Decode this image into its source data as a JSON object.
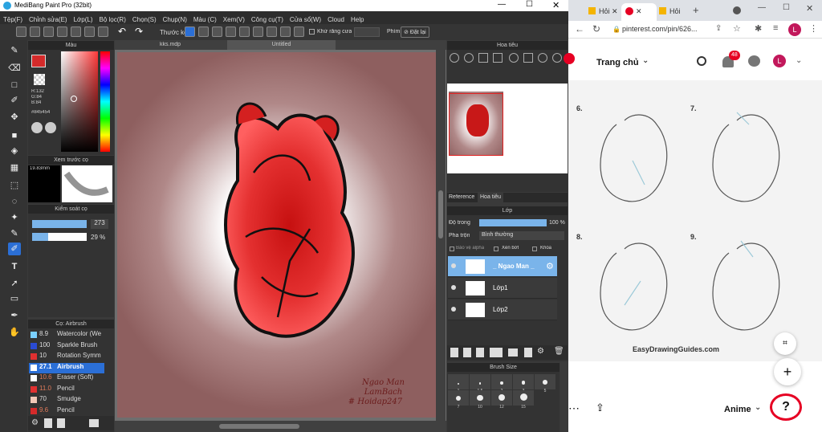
{
  "app": {
    "title": "MediBang Paint Pro (32bit)",
    "menu": [
      "Tệp(F)",
      "Chỉnh sửa(E)",
      "Lớp(L)",
      "Bộ lọc(R)",
      "Chọn(S)",
      "Chụp(N)",
      "Màu (C)",
      "Xem(V)",
      "Công cụ(T)",
      "Cửa sổ(W)",
      "Cloud",
      "Help"
    ],
    "toolbar": {
      "ruler_label": "Thước kẻ",
      "aa_label": "Khử răng cưa",
      "key_label": "Phím",
      "reset_label": "Đặt lại"
    },
    "doc_tabs": [
      "kks.mdp",
      "Untitled"
    ]
  },
  "color_panel": {
    "title": "Màu",
    "rgb": [
      "R:132",
      "G:84",
      "B:84"
    ],
    "hex": "#845454",
    "primary": "#d42a2a"
  },
  "brush_preview": {
    "title": "Xem trước cọ",
    "size": "19.83mm"
  },
  "brush_control": {
    "title": "Kiểm soát cọ",
    "size": "273",
    "opacity": "29 %"
  },
  "brush_list": {
    "title": "Cọ: Airbrush",
    "items": [
      {
        "size": "8.9",
        "name": "Watercolor (We",
        "color": "#7ad0ff"
      },
      {
        "size": "100",
        "name": "Sparkle Brush",
        "color": "#2a4bd4"
      },
      {
        "size": "10",
        "name": "Rotation Symm",
        "color": "#e03030"
      },
      {
        "size": "27.1",
        "name": "Airbrush",
        "color": "#ffffff"
      },
      {
        "size": "10.6",
        "name": "Eraser (Soft)",
        "color": "#ffffff"
      },
      {
        "size": "11.0",
        "name": "Pencil",
        "color": "#e03030"
      },
      {
        "size": "70",
        "name": "Smudge",
        "color": "#f2c8b8"
      },
      {
        "size": "9.6",
        "name": "Pencil",
        "color": "#d42a2a"
      }
    ]
  },
  "canvas": {
    "signature": [
      "Ngao Man",
      "LamBach",
      "# Hoidap247"
    ]
  },
  "navigator": {
    "title": "Hoa tiêu"
  },
  "reference_tabs": [
    "Reference",
    "Hoa tiêu"
  ],
  "layer_panel": {
    "title": "Lớp",
    "opacity_label": "Độ trong",
    "opacity": "100 %",
    "blend_label": "Pha trộn",
    "blend": "Bình thường",
    "checks": [
      "Bảo vệ alpha",
      "Xén bớt",
      "Khóa"
    ],
    "layers": [
      "_ Ngao Man _",
      "Lớp1",
      "Lớp2"
    ]
  },
  "brush_size": {
    "title": "Brush Size",
    "sizes": [
      "1",
      "1.5",
      "2",
      "3",
      "5",
      "7",
      "10",
      "12",
      "15"
    ]
  },
  "browser": {
    "tabs": [
      "Hỏi",
      "",
      "Hỏi"
    ],
    "url": "pinterest.com/pin/626...",
    "avatar": "L",
    "nav_label": "Trang chủ",
    "badge": "48",
    "steps": [
      "6.",
      "7.",
      "8.",
      "9."
    ],
    "watermark": "EasyDrawingGuides.com",
    "board": "Anime",
    "help": "?"
  }
}
